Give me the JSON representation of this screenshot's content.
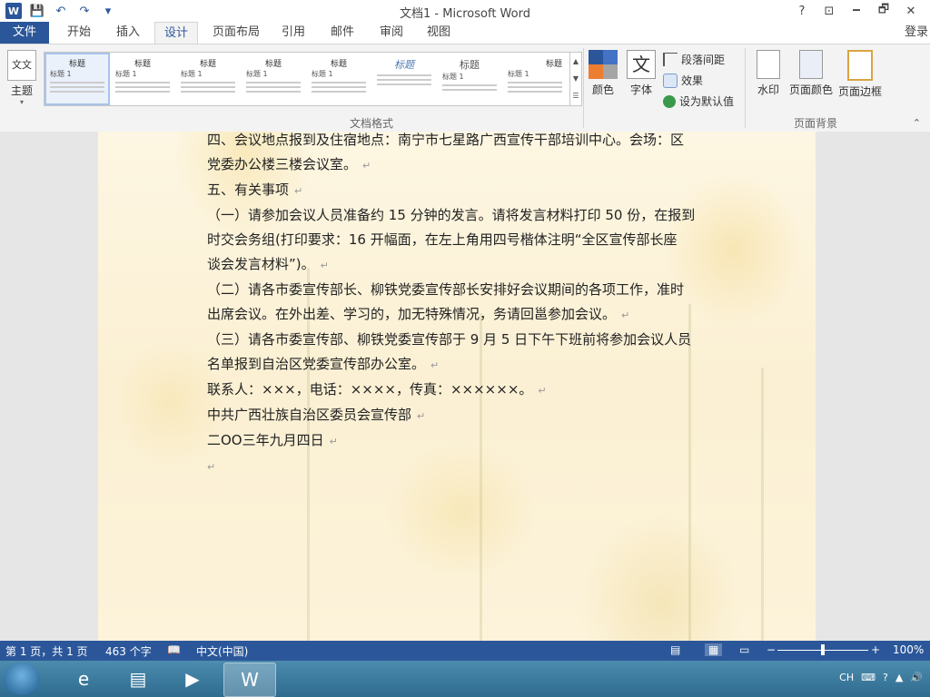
{
  "window": {
    "title": "文档1 - Microsoft Word",
    "help": "?",
    "ribbon_opts": "⊡",
    "minimize": "🗕",
    "restore": "🗗",
    "close": "✕"
  },
  "qat": {
    "word_logo": "W",
    "save": "💾",
    "undo": "↶",
    "redo": "↷",
    "customize": "▾"
  },
  "tabs": {
    "file": "文件",
    "items": [
      "开始",
      "插入",
      "设计",
      "页面布局",
      "引用",
      "邮件",
      "审阅",
      "视图"
    ],
    "active": "设计",
    "login": "登录"
  },
  "ribbon": {
    "theme_label": "主题",
    "theme_icon": "文文",
    "gallery_items": [
      {
        "heading": "标题",
        "sub": "标题 1"
      },
      {
        "heading": "标题",
        "sub": "标题 1"
      },
      {
        "heading": "标题",
        "sub": "标题 1"
      },
      {
        "heading": "标题",
        "sub": "标题 1"
      },
      {
        "heading": "标题",
        "sub": "标题 1"
      },
      {
        "heading": "标题",
        "sub": ""
      },
      {
        "heading": "标题",
        "sub": "标题 1"
      },
      {
        "heading": "标题",
        "sub": "标题 1"
      }
    ],
    "doc_format_label": "文档格式",
    "colors_label": "颜色",
    "fonts_label": "字体",
    "fonts_icon": "文",
    "para_spacing_label": "段落间距",
    "effects_label": "效果",
    "set_default_label": "设为默认值",
    "watermark_label": "水印",
    "page_color_label": "页面颜色",
    "page_border_label": "页面边框",
    "page_bg_label": "页面背景"
  },
  "document": {
    "lines": [
      "四、会议地点报到及住宿地点：南宁市七星路广西宣传干部培训中心。会场：区",
      "党委办公楼三楼会议室。",
      "五、有关事项",
      "（一）请参加会议人员准备约 15 分钟的发言。请将发言材料打印 50 份，在报到",
      "时交会务组(打印要求：16 开幅面，在左上角用四号楷体注明“全区宣传部长座",
      "谈会发言材料”)。",
      "（二）请各市委宣传部长、柳铁党委宣传部长安排好会议期间的各项工作，准时",
      "出席会议。在外出差、学习的，加无特殊情况，务请回邕参加会议。",
      "（三）请各市委宣传部、柳铁党委宣传部于 9 月 5 日下午下班前将参加会议人员",
      "名单报到自治区党委宣传部办公室。",
      "联系人：×××，电话：××××，传真：××××××。",
      "中共广西壮族自治区委员会宣传部",
      "二OO三年九月四日"
    ],
    "paragraph_mark": "↵"
  },
  "status": {
    "page": "第 1 页，共 1 页",
    "words": "463 个字",
    "lang": "中文(中国)",
    "zoom": "100%",
    "zoom_fraction": 0.5
  },
  "taskbar": {
    "tray_lang": "CH"
  },
  "colors": {
    "accent": "#2b579a"
  }
}
